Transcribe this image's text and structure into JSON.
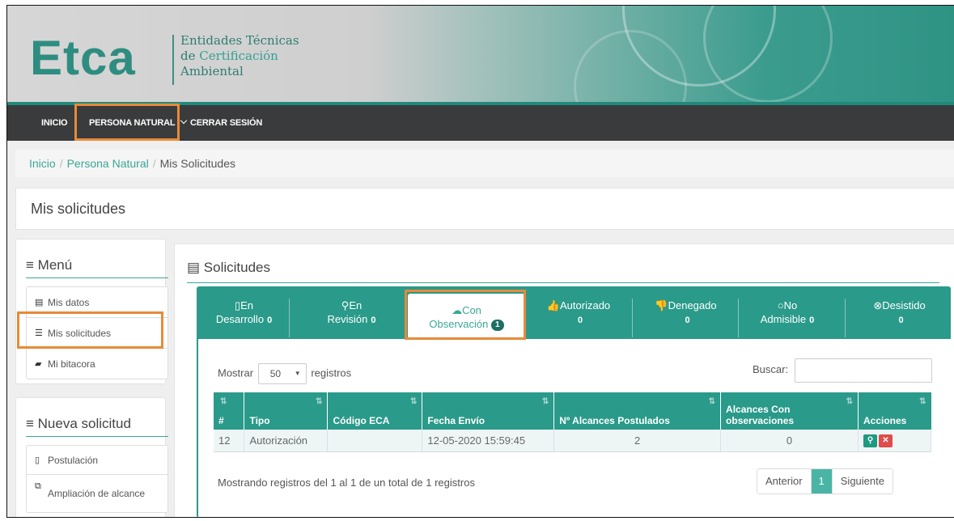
{
  "banner": {
    "logo": "Etca",
    "subtitle_line1": "Entidades Técnicas",
    "subtitle_line2_a": "de ",
    "subtitle_line2_b": "Certificación",
    "subtitle_line3": "Ambiental"
  },
  "navbar": {
    "items": [
      "INICIO",
      "PERSONA NATURAL",
      "CERRAR SESIÓN"
    ],
    "dropdown_caret": "⌄"
  },
  "breadcrumb": [
    "Inicio",
    "Persona Natural",
    "Mis Solicitudes"
  ],
  "page_title": "Mis solicitudes",
  "sidebar": {
    "menu_title": "Menú",
    "menu_items": [
      {
        "icon": "id-card-icon",
        "label": "Mis datos"
      },
      {
        "icon": "list-icon",
        "label": "Mis solicitudes"
      },
      {
        "icon": "book-icon",
        "label": "Mi bitacora"
      }
    ],
    "new_title": "Nueva solicitud",
    "new_items": [
      {
        "icon": "file-icon",
        "label": "Postulación"
      },
      {
        "icon": "copy-icon",
        "label": "Ampliación de alcance"
      }
    ]
  },
  "main": {
    "title": "Solicitudes",
    "tabs": [
      {
        "icon": "file-icon",
        "line1": "En",
        "line2": "Desarrollo",
        "count": "0"
      },
      {
        "icon": "search-icon",
        "line1": "En",
        "line2": "Revisión",
        "count": "0"
      },
      {
        "icon": "comment-icon",
        "line1": "Con",
        "line2": "Observación",
        "count": "1"
      },
      {
        "icon": "thumbs-up-icon",
        "line1": "Autorizado",
        "line2": "",
        "count": "0"
      },
      {
        "icon": "thumbs-down-icon",
        "line1": "Denegado",
        "line2": "",
        "count": "0"
      },
      {
        "icon": "circle-icon",
        "line1": "No",
        "line2": "Admisible",
        "count": "0"
      },
      {
        "icon": "times-circle-icon",
        "line1": "Desistido",
        "line2": "",
        "count": "0"
      }
    ],
    "show_label": "Mostrar",
    "show_value": "50",
    "records_label": "registros",
    "search_label": "Buscar:",
    "search_value": "",
    "columns": [
      "#",
      "Tipo",
      "Código ECA",
      "Fecha Envío",
      "Nº Alcances Postulados",
      "Alcances Con observaciones",
      "Acciones"
    ],
    "rows": [
      {
        "id": "12",
        "tipo": "Autorización",
        "codigo": "",
        "fecha": "12-05-2020 15:59:45",
        "postulados": "2",
        "observaciones": "0"
      }
    ],
    "info": "Mostrando registros del 1 al 1 de un total de 1 registros",
    "pager": {
      "prev": "Anterior",
      "current": "1",
      "next": "Siguiente"
    }
  },
  "colors": {
    "accent": "#2a9a8a",
    "highlight": "#e88a3a",
    "navbar": "#3a3b3c"
  }
}
